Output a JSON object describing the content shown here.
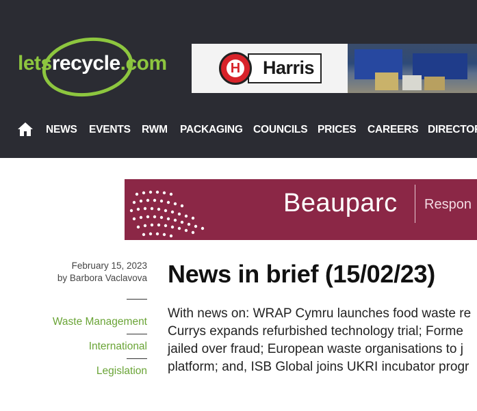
{
  "header": {
    "logo": {
      "part1": "lets",
      "part2": "recycle",
      "part3": ".com"
    },
    "ad_top": {
      "brand": "Harris",
      "badge_letter": "H"
    },
    "nav": {
      "home_icon": "home-icon",
      "items": [
        "NEWS",
        "EVENTS",
        "RWM",
        "PACKAGING",
        "COUNCILS",
        "PRICES",
        "CAREERS",
        "DIRECTOR"
      ]
    }
  },
  "ad_banner": {
    "brand": "Beauparc",
    "tagline": "Respon"
  },
  "article": {
    "date": "February 15, 2023",
    "author": "by Barbora Vaclavova",
    "categories": [
      "Waste Management",
      "International",
      "Legislation"
    ],
    "title": "News in brief (15/02/23)",
    "summary_lines": [
      "With news on: WRAP Cymru launches food waste re",
      "Currys expands refurbished technology trial; Forme",
      "jailed over fraud; European waste organisations to j",
      "platform; and, ISB Global joins UKRI incubator progr"
    ]
  },
  "colors": {
    "header_bg": "#2b2c33",
    "accent_green": "#8dc63f",
    "category_green": "#6aa436",
    "banner_bg": "#8b2746"
  }
}
